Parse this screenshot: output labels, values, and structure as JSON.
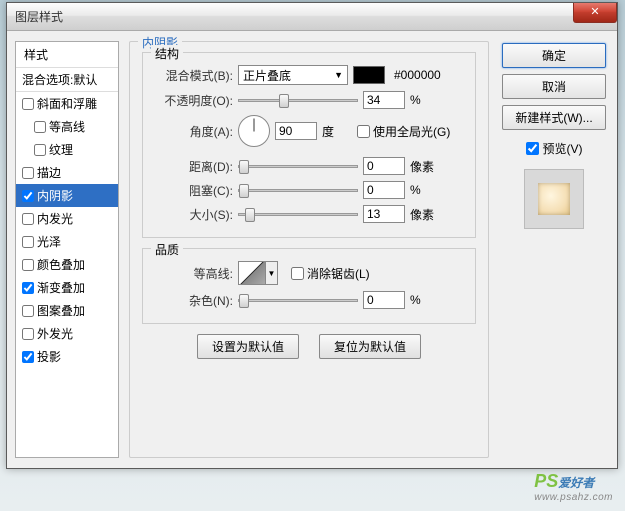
{
  "title": "图层样式",
  "sidebar": {
    "header": "样式",
    "blend": "混合选项:默认",
    "items": [
      {
        "label": "斜面和浮雕",
        "checked": false,
        "sub": false
      },
      {
        "label": "等高线",
        "checked": false,
        "sub": true
      },
      {
        "label": "纹理",
        "checked": false,
        "sub": true
      },
      {
        "label": "描边",
        "checked": false,
        "sub": false
      },
      {
        "label": "内阴影",
        "checked": true,
        "sub": false,
        "selected": true
      },
      {
        "label": "内发光",
        "checked": false,
        "sub": false
      },
      {
        "label": "光泽",
        "checked": false,
        "sub": false
      },
      {
        "label": "颜色叠加",
        "checked": false,
        "sub": false
      },
      {
        "label": "渐变叠加",
        "checked": true,
        "sub": false
      },
      {
        "label": "图案叠加",
        "checked": false,
        "sub": false
      },
      {
        "label": "外发光",
        "checked": false,
        "sub": false
      },
      {
        "label": "投影",
        "checked": true,
        "sub": false
      }
    ]
  },
  "panel": {
    "title": "内阴影",
    "structure": {
      "title": "结构",
      "blend_label": "混合模式(B):",
      "blend_value": "正片叠底",
      "hex": "#000000",
      "opacity_label": "不透明度(O):",
      "opacity_value": "34",
      "opacity_unit": "%",
      "angle_label": "角度(A):",
      "angle_value": "90",
      "angle_unit": "度",
      "global_light": "使用全局光(G)",
      "distance_label": "距离(D):",
      "distance_value": "0",
      "distance_unit": "像素",
      "choke_label": "阻塞(C):",
      "choke_value": "0",
      "choke_unit": "%",
      "size_label": "大小(S):",
      "size_value": "13",
      "size_unit": "像素"
    },
    "quality": {
      "title": "品质",
      "contour_label": "等高线:",
      "antialias": "消除锯齿(L)",
      "noise_label": "杂色(N):",
      "noise_value": "0",
      "noise_unit": "%"
    },
    "default_btn": "设置为默认值",
    "reset_btn": "复位为默认值"
  },
  "right": {
    "ok": "确定",
    "cancel": "取消",
    "new_style": "新建样式(W)...",
    "preview": "预览(V)"
  },
  "watermark": {
    "ps": "PS",
    "cn": "爱好者",
    "url": "www.psahz.com"
  }
}
